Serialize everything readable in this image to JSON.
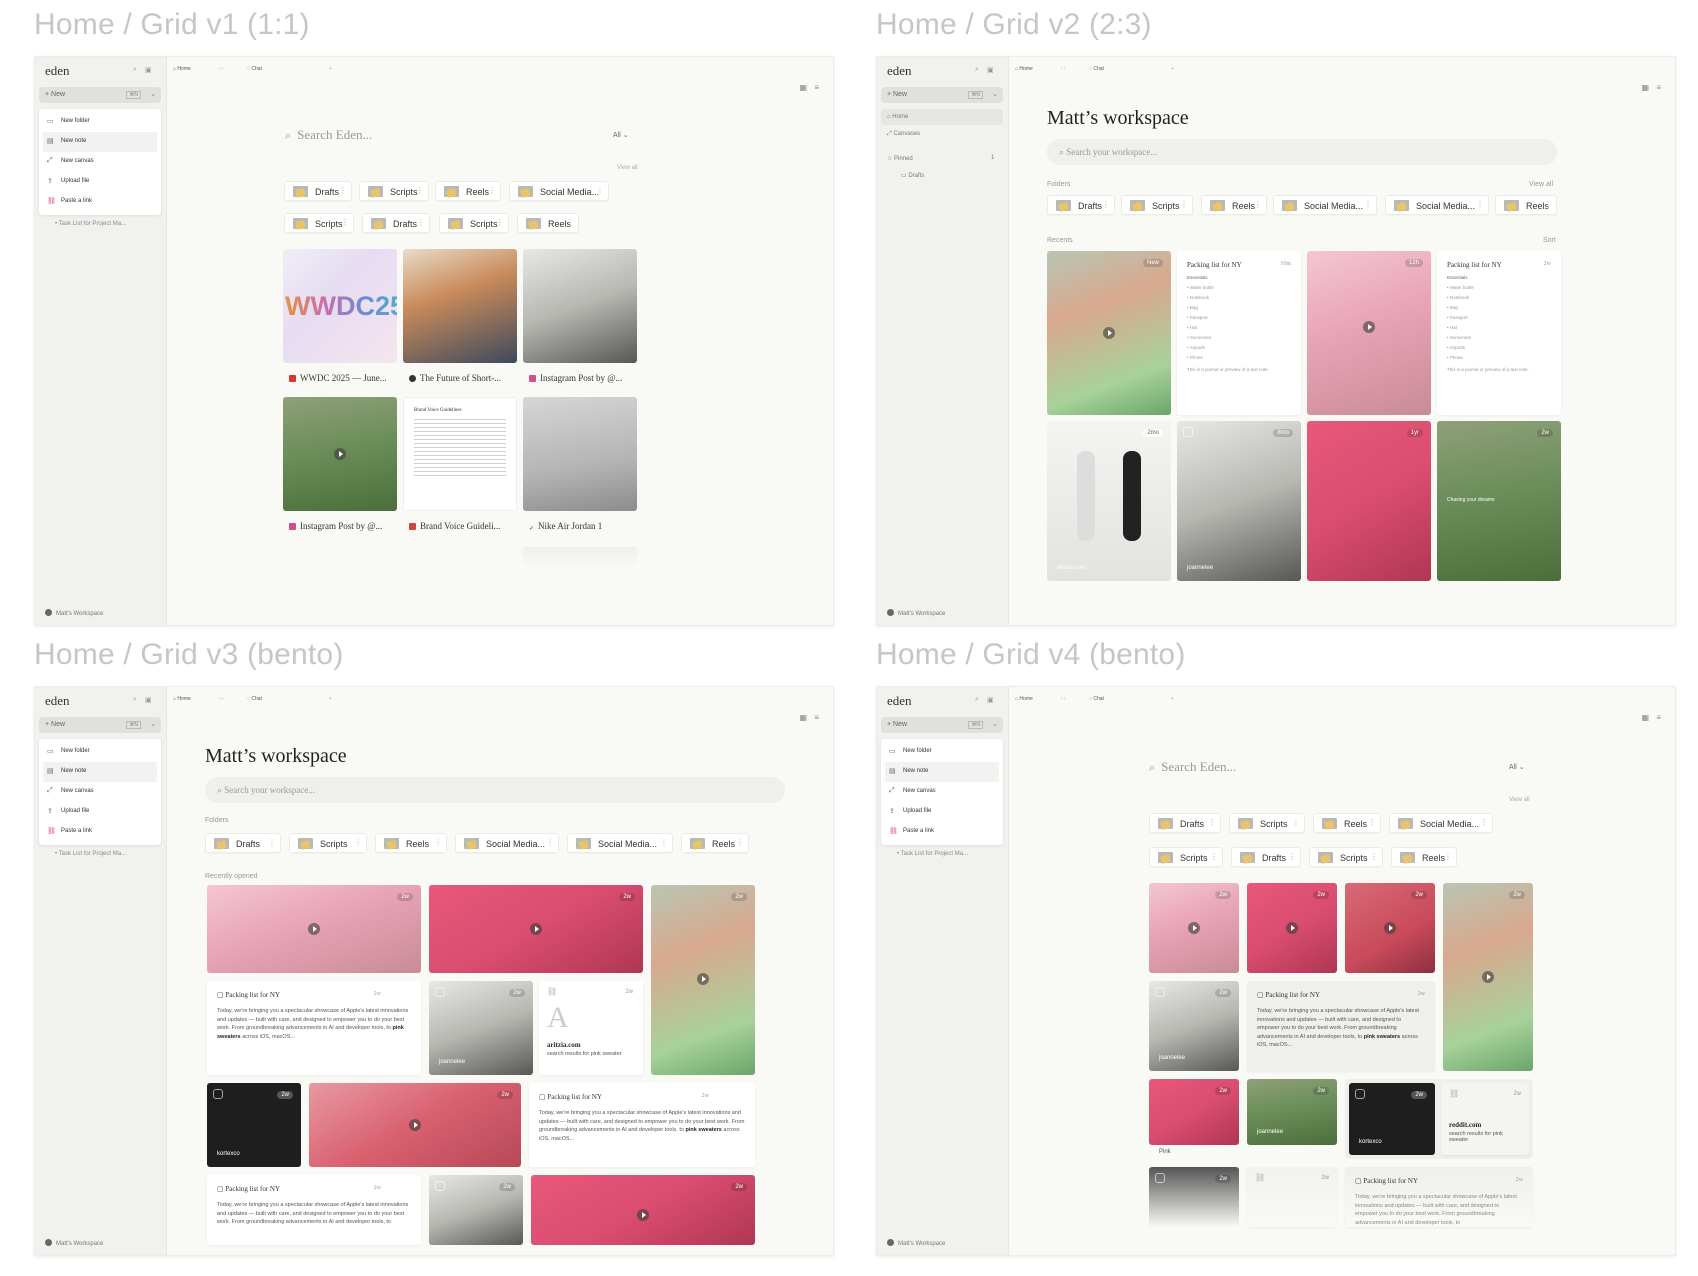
{
  "frames": [
    {
      "label": "Home / Grid v1 (1:1)"
    },
    {
      "label": "Home / Grid v2 (2:3)"
    },
    {
      "label": "Home / Grid v3 (bento)"
    },
    {
      "label": "Home / Grid v4 (bento)"
    }
  ],
  "app": {
    "logo": "eden",
    "new_label": "+ New",
    "new_shortcut": "⌘N",
    "tab_home": "Home",
    "tab_chat": "Chat",
    "tab_add": "+",
    "workspace_name": "Matt's Workspace",
    "menu": [
      "New folder",
      "New note",
      "New canvas",
      "Upload file",
      "Paste a link"
    ],
    "task": "Task List for Project Ma...",
    "nav_home": "Home",
    "nav_canvases": "Canvases",
    "nav_pinned": "Pinned",
    "nav_pinned_count": "1",
    "nav_drafts": "Drafts"
  },
  "search": {
    "placeholder": "Search Eden...",
    "filter": "All",
    "view_all": "View all"
  },
  "workspace": {
    "title": "Matt’s workspace",
    "search_placeholder": "Search your workspace...",
    "folders": "Folders",
    "recents": "Recents",
    "sort": "Sort",
    "view_all": "View all",
    "recently_opened": "Recently opened"
  },
  "v1": {
    "chips_row1": [
      "Drafts",
      "Scripts",
      "Reels",
      "Social Media..."
    ],
    "chips_row2": [
      "Scripts",
      "Drafts",
      "Scripts",
      "Reels"
    ],
    "wwdc_text": "WWDC25",
    "doc_title": "Brand Voice Guidelines",
    "captions": [
      "WWDC 2025 — June...",
      "The Future of Short-...",
      "Instagram Post by @...",
      "Instagram Post by @...",
      "Brand Voice Guideli...",
      "Nike Air Jordan 1"
    ]
  },
  "v2": {
    "chips": [
      "Drafts",
      "Scripts",
      "Reels",
      "Social Media...",
      "Social Media...",
      "Reels"
    ],
    "badges": [
      "New",
      "10m",
      "12h",
      "2w",
      "2mo",
      "8mo",
      "1yr",
      "2w"
    ],
    "note_title": "Packing list for NY",
    "note_heading": "Essentials",
    "note_items": [
      "Water bottle",
      "Notebook",
      "Bag",
      "Passport",
      "Hat",
      "Sunscreen",
      "Airpods",
      "Phone"
    ],
    "note_footer": "This is a journal or preview of a text note.",
    "overlay_text": "Chasing your dreams",
    "handle1": "aritzia.com",
    "handle2": "joannelee"
  },
  "v3": {
    "chips": [
      "Drafts",
      "Scripts",
      "Reels",
      "Social Media...",
      "Social Media...",
      "Reels"
    ],
    "age": "2w",
    "note_title": "Packing list for NY",
    "note_body": "Today, we're bringing you a spectacular showcase of Apple's latest innovations and updates — built with care, and designed to empower you to do your best work. From groundbreaking advancements in AI and developer tools, to",
    "note_bold": "pink sweaters",
    "note_tail": "across iOS, macOS...",
    "handle_joan": "joannelee",
    "handle_kort": "kortexco",
    "link_domain": "aritzia.com",
    "link_desc": "search results for pink sweater"
  },
  "v4": {
    "chips_row1": [
      "Drafts",
      "Scripts",
      "Reels",
      "Social Media..."
    ],
    "chips_row2": [
      "Scripts",
      "Drafts",
      "Scripts",
      "Reels"
    ],
    "age": "2w",
    "pink_label": "Pink",
    "link_domain": "reddit.com",
    "link_desc": "search results for pink sweater"
  }
}
